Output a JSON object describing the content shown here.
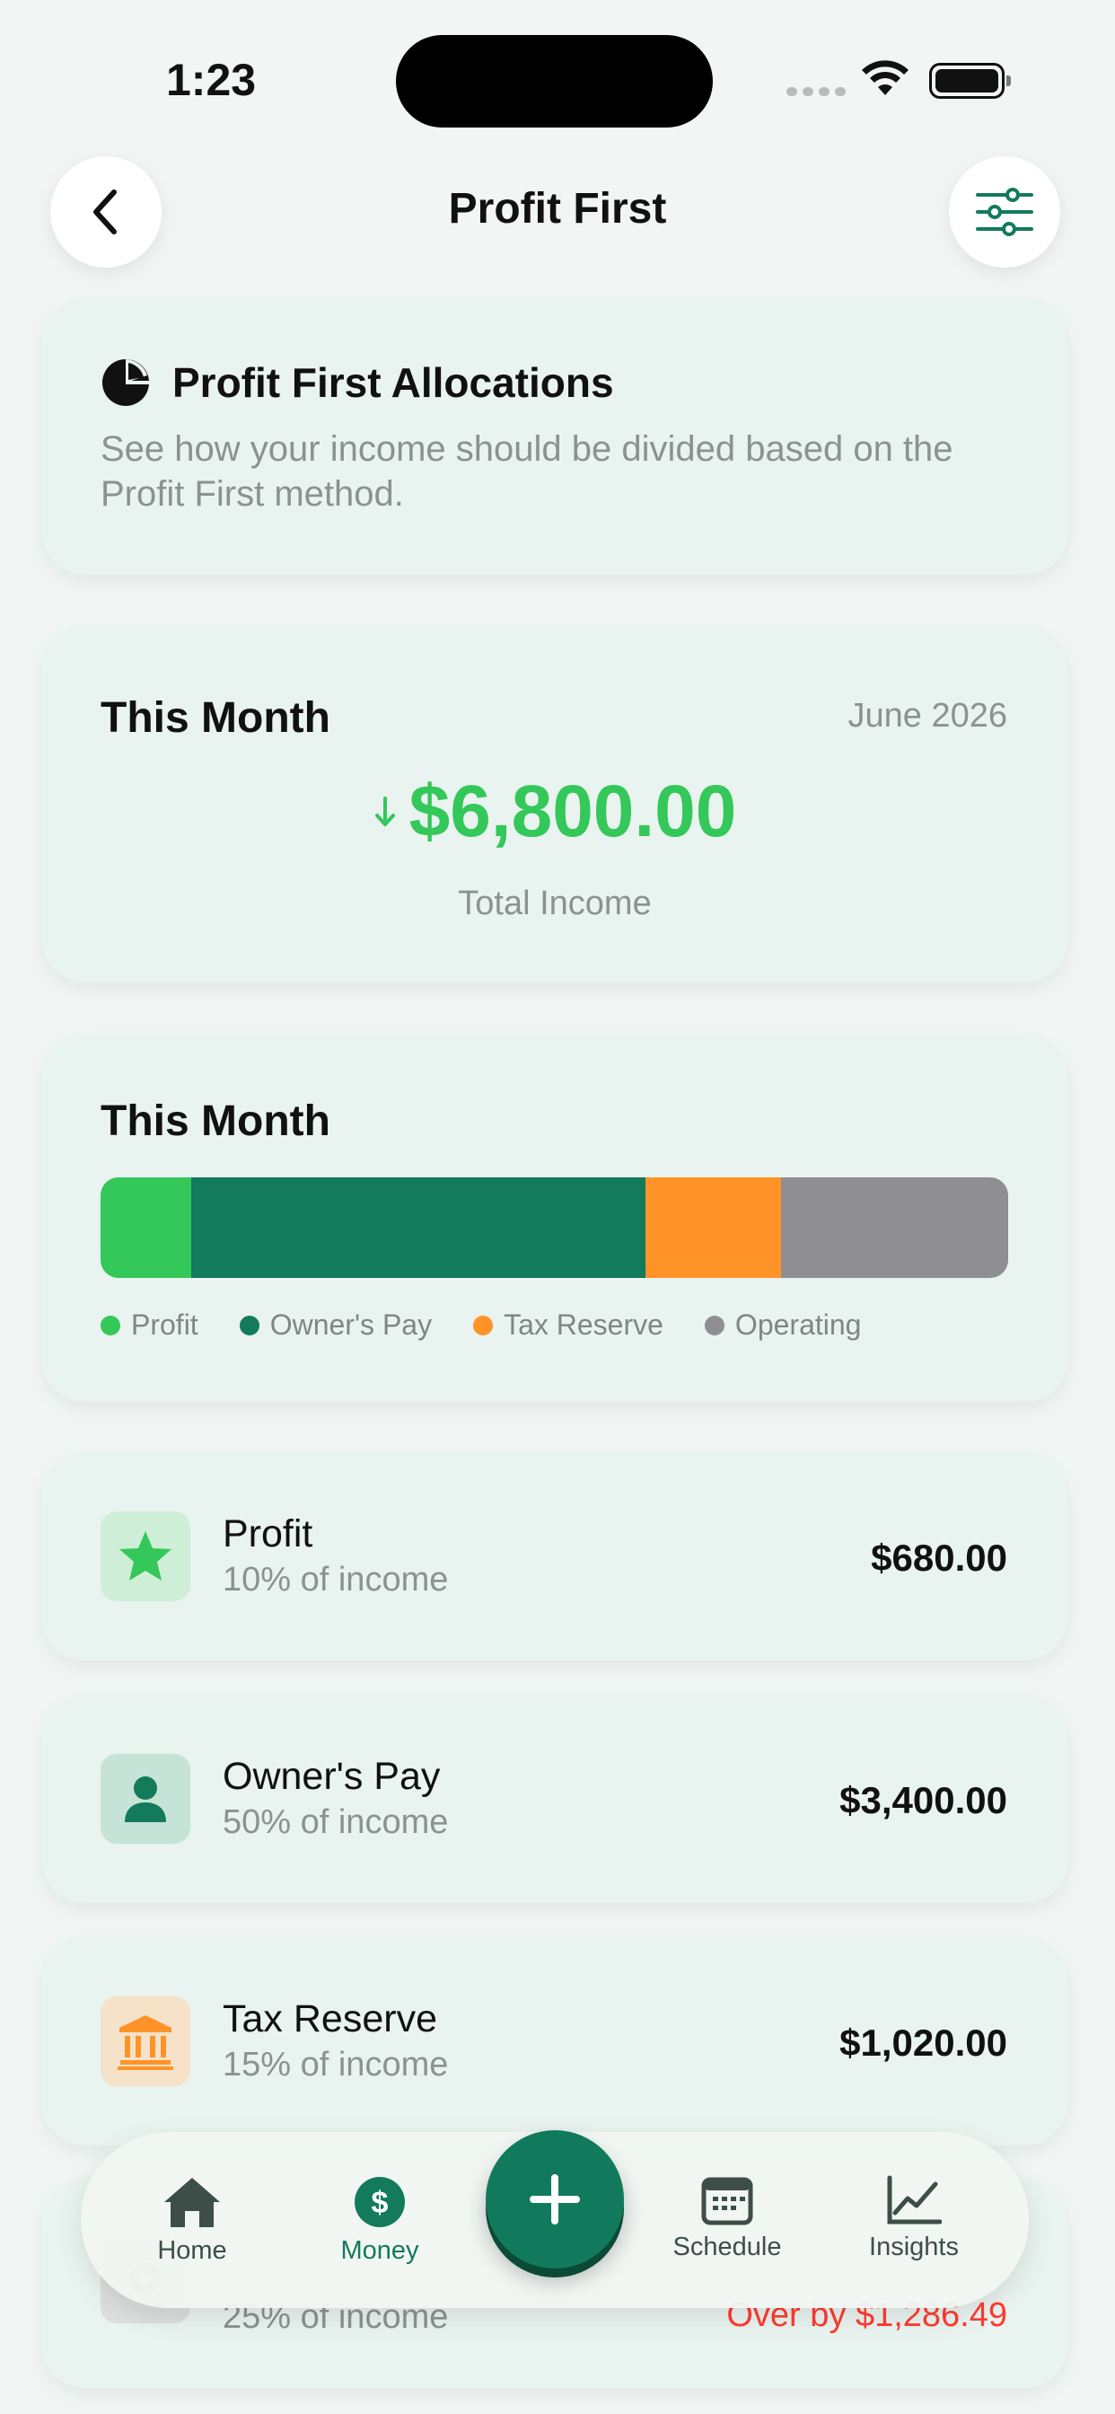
{
  "status_bar": {
    "time": "1:23"
  },
  "header": {
    "title": "Profit First"
  },
  "intro": {
    "title": "Profit First Allocations",
    "description": "See how your income should be divided based on the Profit First method."
  },
  "summary": {
    "label": "This Month",
    "date": "June 2026",
    "total": "$6,800.00",
    "total_label": "Total Income"
  },
  "allocation_bar": {
    "title": "This Month",
    "segments": [
      {
        "name": "Profit",
        "percent": 10,
        "color": "#34c759"
      },
      {
        "name": "Owner's Pay",
        "percent": 50,
        "color": "#137a5c"
      },
      {
        "name": "Tax Reserve",
        "percent": 15,
        "color": "#ff9328"
      },
      {
        "name": "Operating",
        "percent": 25,
        "color": "#8e8e93"
      }
    ]
  },
  "allocations": [
    {
      "name": "Profit",
      "subtitle": "10% of income",
      "amount": "$680.00",
      "icon": "star-icon",
      "color": "#34c759"
    },
    {
      "name": "Owner's Pay",
      "subtitle": "50% of income",
      "amount": "$3,400.00",
      "icon": "person-icon",
      "color": "#137a5c"
    },
    {
      "name": "Tax Reserve",
      "subtitle": "15% of income",
      "amount": "$1,020.00",
      "icon": "bank-icon",
      "color": "#ff9328"
    },
    {
      "name": "",
      "subtitle": "25% of income",
      "amount": "Over by $1,286.49",
      "icon": "gear-icon",
      "color": "#8e8e93"
    }
  ],
  "tabbar": {
    "tabs": [
      {
        "label": "Home",
        "icon": "house-icon"
      },
      {
        "label": "Money",
        "icon": "dollar-circle-icon",
        "active": true
      },
      {
        "label": "Schedule",
        "icon": "calendar-icon"
      },
      {
        "label": "Insights",
        "icon": "chart-line-icon"
      }
    ],
    "fab_icon": "plus-icon"
  }
}
